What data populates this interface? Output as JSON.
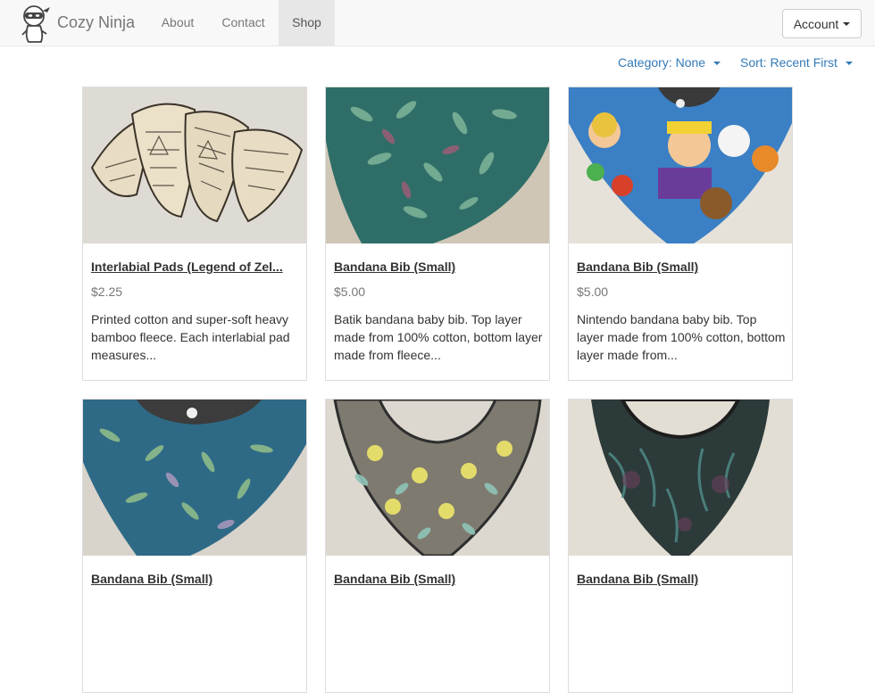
{
  "navbar": {
    "brand": "Cozy Ninja",
    "links": [
      "About",
      "Contact",
      "Shop"
    ],
    "active_link": "Shop",
    "account_label": "Account"
  },
  "filters": {
    "category": "Category: None",
    "sort": "Sort: Recent First"
  },
  "products": [
    {
      "title": "Interlabial Pads (Legend of Zel...",
      "price": "$2.25",
      "description": "Printed cotton and super-soft heavy bamboo fleece. Each interlabial pad measures...",
      "image": "cream-zelda-print-pads"
    },
    {
      "title": "Bandana Bib (Small)",
      "price": "$5.00",
      "description": "Batik bandana baby bib. Top layer made from 100% cotton, bottom layer made from fleece...",
      "image": "teal-batik-bib"
    },
    {
      "title": "Bandana Bib (Small)",
      "price": "$5.00",
      "description": "Nintendo bandana baby bib. Top layer made from 100% cotton, bottom layer made from...",
      "image": "nintendo-character-bib"
    },
    {
      "title": "Bandana Bib (Small)",
      "price": "",
      "description": "",
      "image": "blue-batik-bib"
    },
    {
      "title": "Bandana Bib (Small)",
      "price": "",
      "description": "",
      "image": "grey-floral-bib"
    },
    {
      "title": "Bandana Bib (Small)",
      "price": "",
      "description": "",
      "image": "dark-batik-bib"
    }
  ],
  "colors": {
    "link": "#337ab7",
    "navbar_bg": "#f8f8f8",
    "active_nav_bg": "#e7e7e7"
  }
}
